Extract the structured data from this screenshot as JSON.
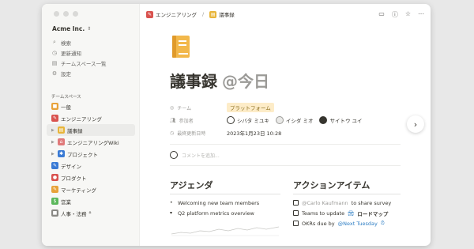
{
  "sidebar": {
    "workspace": "Acme Inc.",
    "nav": [
      {
        "icon": "search-icon",
        "glyph": "⌕",
        "label": "検索"
      },
      {
        "icon": "clock-icon",
        "glyph": "◷",
        "label": "更新通知"
      },
      {
        "icon": "grid-icon",
        "glyph": "▤",
        "label": "チームスペース一覧"
      },
      {
        "icon": "gear-icon",
        "glyph": "⚙",
        "label": "設定"
      }
    ],
    "section_label": "チームスペース",
    "teams": [
      {
        "label": "一般",
        "color": "#e8a23a",
        "glyph": "■"
      },
      {
        "label": "エンジニアリング",
        "color": "#d9534f",
        "glyph": "✎"
      },
      {
        "label": "議事録",
        "color": "#e8b53a",
        "glyph": "▤"
      },
      {
        "label": "エンジニアリングWiki",
        "color": "#e07a7a",
        "glyph": "⌂"
      },
      {
        "label": "プロジェクト",
        "color": "#3a7bd5",
        "glyph": "✱"
      },
      {
        "label": "デザイン",
        "color": "#3a7bd5",
        "glyph": "✎"
      },
      {
        "label": "プロダクト",
        "color": "#d9534f",
        "glyph": "●"
      },
      {
        "label": "マーケティング",
        "color": "#e8a23a",
        "glyph": "✎"
      },
      {
        "label": "営業",
        "color": "#5cb85c",
        "glyph": "$"
      },
      {
        "label": "人事・法務",
        "color": "#8a8985",
        "glyph": "■"
      }
    ]
  },
  "breadcrumb": {
    "parent": "エンジニアリング",
    "separator": "/",
    "current": "議事録"
  },
  "page": {
    "title": "議事録",
    "title_mention": "@今日",
    "props": {
      "team_label": "チーム",
      "team_value": "プラットフォーム",
      "participants_label": "参加者",
      "participants": [
        "シバタ ミユキ",
        "イシダ ミオ",
        "サイトウ ユイ"
      ],
      "updated_label": "最終更新日時",
      "updated_value": "2023年1月23日 10:28"
    },
    "comment_placeholder": "コメントを追加...",
    "agenda": {
      "heading": "アジェンダ",
      "items": [
        "Welcoming new team members",
        "Q2 platform metrics overview"
      ]
    },
    "actions": {
      "heading": "アクションアイテム",
      "item1_mention": "@Carlo Kaufmann",
      "item1_text": "to share survey",
      "item2_text": "Teams to update",
      "item2_link": "ロードマップ",
      "item3_text": "OKRs due by",
      "item3_mention": "@Next Tuesday"
    }
  },
  "colors": {
    "accent": "#2e7ec4",
    "tag_bg": "#fdecc8"
  }
}
